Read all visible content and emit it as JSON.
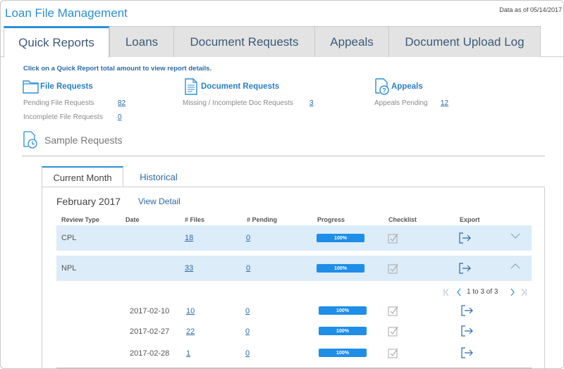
{
  "app": {
    "title": "Loan File Management",
    "data_as_of": "Data as of 05/14/2017"
  },
  "tabs": [
    {
      "label": "Quick Reports",
      "active": true
    },
    {
      "label": "Loans",
      "active": false
    },
    {
      "label": "Document Requests",
      "active": false
    },
    {
      "label": "Appeals",
      "active": false
    },
    {
      "label": "Document Upload Log",
      "active": false
    }
  ],
  "quick_reports": {
    "instruction": "Click on a Quick Report total amount to view report details.",
    "file_requests": {
      "title": "File Requests",
      "icon": "folder-icon",
      "rows": [
        {
          "label": "Pending File Requests",
          "value": "82"
        },
        {
          "label": "Incomplete File Requests",
          "value": "0"
        }
      ]
    },
    "document_requests": {
      "title": "Document Requests",
      "icon": "document-icon",
      "rows": [
        {
          "label": "Missing / Incomplete Doc Requests",
          "value": "3"
        }
      ]
    },
    "appeals": {
      "title": "Appeals",
      "icon": "question-document-icon",
      "rows": [
        {
          "label": "Appeals Pending",
          "value": "12"
        }
      ]
    }
  },
  "sample_requests": {
    "title": "Sample Requests",
    "icon": "document-clock-icon",
    "sub_tabs": [
      {
        "label": "Current Month",
        "active": true
      },
      {
        "label": "Historical",
        "active": false
      }
    ],
    "period": "February 2017",
    "view_detail": "View Detail",
    "columns": [
      "Review Type",
      "Date",
      "# Files",
      "# Pending",
      "Progress",
      "Checklist",
      "Export"
    ],
    "rows": [
      {
        "review_type": "CPL",
        "files": "18",
        "pending": "0",
        "progress": "100%",
        "expanded": false
      },
      {
        "review_type": "NPL",
        "files": "33",
        "pending": "0",
        "progress": "100%",
        "expanded": true
      }
    ],
    "pager": {
      "text": "1 to 3 of 3"
    },
    "sub_rows": [
      {
        "date": "2017-02-10",
        "files": "10",
        "pending": "0",
        "progress": "100%"
      },
      {
        "date": "2017-02-27",
        "files": "22",
        "pending": "0",
        "progress": "100%"
      },
      {
        "date": "2017-02-28",
        "files": "1",
        "pending": "0",
        "progress": "100%"
      }
    ]
  },
  "colors": {
    "accent": "#2b8fd6",
    "progress": "#1e8ee8",
    "row_highlight": "#dcecf8",
    "link": "#2b6aa6"
  }
}
